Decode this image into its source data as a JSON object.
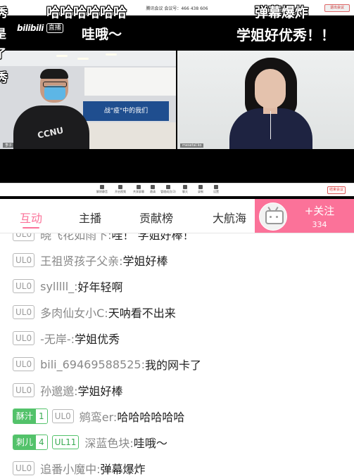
{
  "player": {
    "meeting_title": "腾讯会议  会议号：466 438 606",
    "meeting_exit_top": "退出会议",
    "logo_text": "bilibili",
    "logo_badge": "直播",
    "banner_text": "战\"疫\"中的我们",
    "left_shirt_text": "CCNU",
    "left_pane_label": "李子",
    "right_pane_label": "mesetal.ko",
    "toolbar": [
      {
        "label": "解除静音"
      },
      {
        "label": "开启视频"
      },
      {
        "label": "共享屏幕"
      },
      {
        "label": "邀请"
      },
      {
        "label": "管理成员(3)"
      },
      {
        "label": "聊天"
      },
      {
        "label": "录制"
      },
      {
        "label": "设置"
      }
    ],
    "toolbar_exit": "结束会议",
    "danmaku": {
      "top_center": "哈哈哈哈哈哈",
      "top_right": "弹幕爆炸",
      "left_mid": "哇哦〜",
      "right_mid": "学姐好优秀！！",
      "edge_1": "秀",
      "edge_2": "是",
      "edge_3": "了",
      "edge_4": "秀"
    }
  },
  "tabs": [
    {
      "label": "互动",
      "active": true
    },
    {
      "label": "主播",
      "active": false
    },
    {
      "label": "贡献榜",
      "active": false
    },
    {
      "label": "大航海",
      "active": false
    }
  ],
  "follow": {
    "label": "+关注",
    "count": "334"
  },
  "colors": {
    "accent_pink": "#fb7299",
    "fan_green": "#53c26a"
  },
  "chat": [
    {
      "level": "UL0",
      "user": "晓飞花如雨下",
      "text": "哇！ 学姐好棒！",
      "clipped": true
    },
    {
      "level": "UL0",
      "user": "王祖贤孩子父亲",
      "text": "学姐好棒"
    },
    {
      "level": "UL0",
      "user": "sylllll_",
      "text": "好年轻啊"
    },
    {
      "level": "UL0",
      "user": "多肉仙女小C",
      "text": "天呐看不出来"
    },
    {
      "level": "UL0",
      "user": "-无岸-",
      "text": "学姐优秀"
    },
    {
      "level": "UL0",
      "user": "bili_69469588525",
      "text": "我的网卡了"
    },
    {
      "level": "UL0",
      "user": "孙邈邈",
      "text": "学姐好棒"
    },
    {
      "fan_name": "酥汁",
      "fan_level": "1",
      "level": "UL0",
      "user": "鹓鸾er",
      "text": "哈哈哈哈哈哈"
    },
    {
      "fan_name": "刺儿",
      "fan_level": "4",
      "level": "UL11",
      "level_green": true,
      "user": "深蓝色块",
      "text": "哇哦～"
    },
    {
      "level": "UL0",
      "user": "追番小魔中",
      "text": "弹幕爆炸"
    }
  ]
}
